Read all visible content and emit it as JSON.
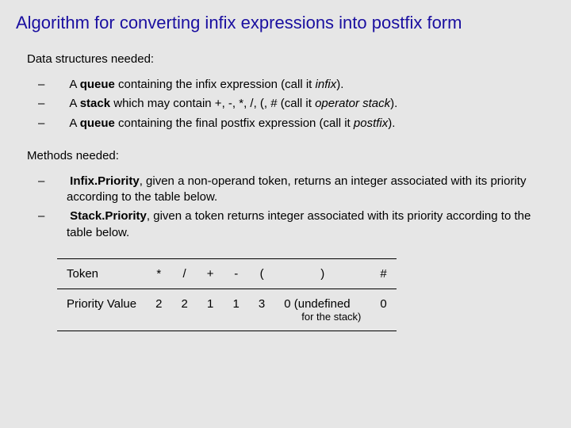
{
  "title": "Algorithm for converting infix expressions into postfix form",
  "section1": {
    "label": "Data structures needed:",
    "items": [
      {
        "pre": "A ",
        "bold": "queue",
        "mid": " containing the infix expression   (call it ",
        "ital": "infix",
        "post": ")."
      },
      {
        "pre": "A ",
        "bold": "stack",
        "mid": " which may contain +, -, *, /, (, #   (call it ",
        "ital": "operator stack",
        "post": ")."
      },
      {
        "pre": "A ",
        "bold": "queue",
        "mid": " containing the final postfix expression   (call it ",
        "ital": "postfix",
        "post": ")."
      }
    ]
  },
  "section2": {
    "label": "Methods needed:",
    "items": [
      {
        "bold": "Infix.Priority",
        "rest": ", given  a non-operand token, returns an integer associated with its priority according to the table below."
      },
      {
        "bold": "Stack.Priority",
        "rest": ", given a token returns integer associated with its priority according to the table below."
      }
    ]
  },
  "table": {
    "header": [
      "Token",
      "*",
      "/",
      "+",
      "-",
      "(",
      ")",
      "#"
    ],
    "rowLabel": "Priority Value",
    "values": [
      "2",
      "2",
      "1",
      "1",
      "3",
      "0 (undefined",
      "0"
    ],
    "note": "for the stack)"
  }
}
